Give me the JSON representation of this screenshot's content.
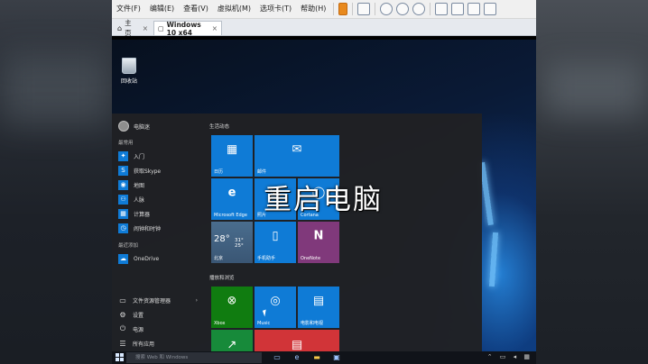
{
  "vm_menu": [
    "文件(F)",
    "编辑(E)",
    "查看(V)",
    "虚拟机(M)",
    "选项卡(T)",
    "帮助(H)"
  ],
  "tabs": {
    "home": "主页",
    "active": "Windows 10 x64",
    "close": "×"
  },
  "desktop": {
    "recycle_bin": "回收站"
  },
  "start_menu": {
    "user": "电脑迷",
    "most_used_title": "最常用",
    "most_used": [
      {
        "label": "入门",
        "icon": "lightbulb-icon",
        "color": "#0f7bd6"
      },
      {
        "label": "获取Skype",
        "icon": "skype-icon",
        "color": "#0f7bd6"
      },
      {
        "label": "地图",
        "icon": "maps-icon",
        "color": "#0f7bd6"
      },
      {
        "label": "人脉",
        "icon": "people-icon",
        "color": "#0f7bd6"
      },
      {
        "label": "计算器",
        "icon": "calculator-icon",
        "color": "#0f7bd6"
      },
      {
        "label": "闹钟和时钟",
        "icon": "alarm-icon",
        "color": "#0f7bd6"
      }
    ],
    "recent_title": "最近添加",
    "recent": [
      {
        "label": "OneDrive",
        "icon": "onedrive-icon",
        "color": "#0f7bd6"
      }
    ],
    "system": [
      {
        "label": "文件资源管理器",
        "icon": "folder-icon",
        "arrow": "›"
      },
      {
        "label": "设置",
        "icon": "gear-icon"
      },
      {
        "label": "电源",
        "icon": "power-icon"
      },
      {
        "label": "所有应用",
        "icon": "list-icon"
      }
    ],
    "group1_title": "生活动态",
    "group2_title": "播放和浏览",
    "tiles": {
      "calendar": "日历",
      "mail": "邮件",
      "edge": "Microsoft Edge",
      "photos": "照片",
      "cortana": "Cortana",
      "weather_temp": "28°",
      "weather_range": "31° 25°",
      "weather_city": "北京",
      "phone": "手机助手",
      "onenote": "OneNote",
      "xbox": "Xbox",
      "groove": "Music",
      "movies": "电影和电视"
    }
  },
  "overlay_text": "重启电脑",
  "taskbar": {
    "search_placeholder": "搜索 Web 和 Windows"
  }
}
